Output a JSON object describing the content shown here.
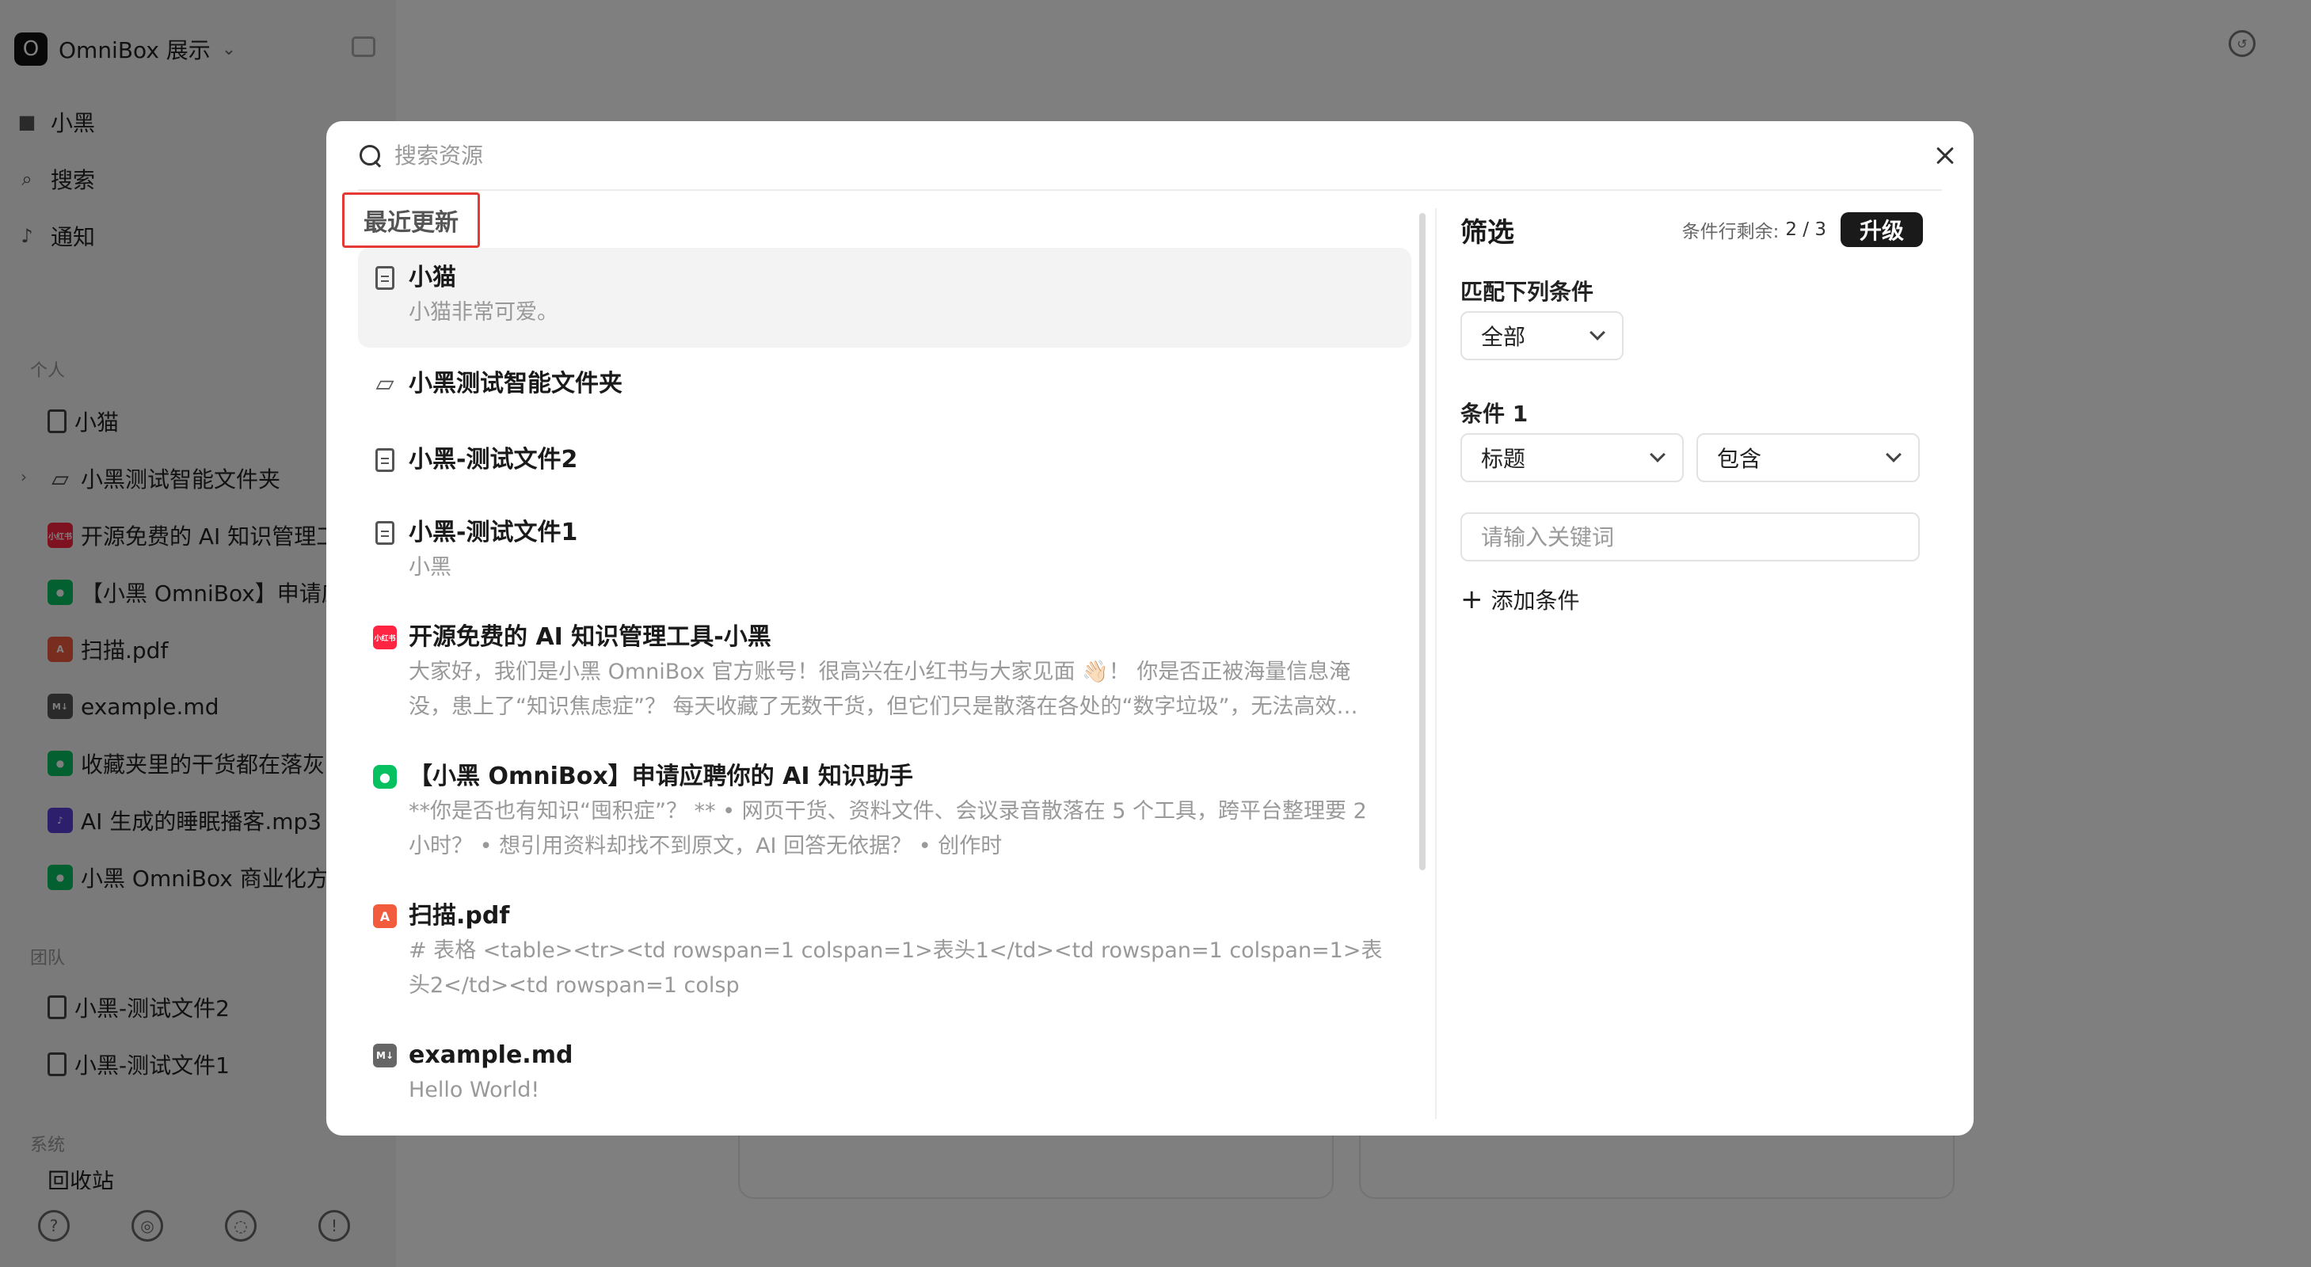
{
  "sidebar": {
    "workspace_name": "OmniBox 展示",
    "nav": [
      {
        "label": "小黑",
        "icon": "avatar-icon"
      },
      {
        "label": "搜索",
        "icon": "search-icon"
      },
      {
        "label": "通知",
        "icon": "bell-icon"
      }
    ],
    "section_personal": "个人",
    "personal_items": [
      {
        "label": "小猫",
        "icon": "document-icon"
      },
      {
        "label": "小黑测试智能文件夹",
        "icon": "smart-folder-icon"
      },
      {
        "label": "开源免费的 AI 知识管理工具-小黑",
        "icon": "xiaohongshu-icon"
      },
      {
        "label": "【小黑 OmniBox】申请应聘你的 AI 知识助手",
        "icon": "wechat-icon"
      },
      {
        "label": "扫描.pdf",
        "icon": "pdf-icon"
      },
      {
        "label": "example.md",
        "icon": "markdown-icon"
      },
      {
        "label": "收藏夹里的干货都在落灰",
        "icon": "wechat-icon"
      },
      {
        "label": "AI 生成的睡眠播客.mp3",
        "icon": "audio-icon"
      },
      {
        "label": "小黑 OmniBox 商业化方案",
        "icon": "wechat-icon"
      }
    ],
    "section_team": "团队",
    "team_items": [
      {
        "label": "小黑-测试文件2",
        "icon": "document-icon"
      },
      {
        "label": "小黑-测试文件1",
        "icon": "document-icon"
      }
    ],
    "section_system": "系统",
    "system_partial": "回收站"
  },
  "modal": {
    "search_placeholder": "搜索资源",
    "recent_label": "最近更新",
    "results": [
      {
        "title": "小猫",
        "snippet": "小猫非常可爱。",
        "icon": "document-icon"
      },
      {
        "title": "小黑测试智能文件夹",
        "snippet": "",
        "icon": "smart-folder-icon"
      },
      {
        "title": "小黑-测试文件2",
        "snippet": "",
        "icon": "document-icon"
      },
      {
        "title": "小黑-测试文件1",
        "snippet": "小黑",
        "icon": "document-icon"
      },
      {
        "title": "开源免费的 AI 知识管理工具-小黑",
        "snippet": "大家好，我们是小黑 OmniBox 官方账号！很高兴在小红书与大家见面 👋🏻！ 你是否正被海量信息淹没，患上了“知识焦虑症”？ 每天收藏了无数干货，但它们只是散落在各处的“数字垃圾”，无法高效…",
        "icon": "xiaohongshu-icon",
        "badge": "小红书"
      },
      {
        "title": "【小黑 OmniBox】申请应聘你的 AI 知识助手",
        "snippet": "**你是否也有知识“囤积症”？ ** • 网页干货、资料文件、会议录音散落在 5 个工具，跨平台整理要 2 小时？ • 想引用资料却找不到原文，AI 回答无依据？ • 创作时",
        "icon": "wechat-icon"
      },
      {
        "title": "扫描.pdf",
        "snippet": "# 表格 <table><tr><td rowspan=1 colspan=1>表头1</td><td rowspan=1 colspan=1>表头2</td><td rowspan=1 colsp",
        "icon": "pdf-icon"
      },
      {
        "title": "example.md",
        "snippet": "Hello World!",
        "icon": "markdown-icon",
        "badge": "M↓"
      }
    ],
    "filter": {
      "title": "筛选",
      "remaining_label": "条件行剩余:",
      "remaining_count": "2 / 3",
      "upgrade_label": "升级",
      "match_label": "匹配下列条件",
      "match_value": "全部",
      "condition_label": "条件 1",
      "field_value": "标题",
      "operator_value": "包含",
      "keyword_placeholder": "请输入关键词",
      "add_condition_label": "添加条件"
    }
  },
  "colors": {
    "accent_dark": "#1a1a1a",
    "highlight_border": "#e53935",
    "xiaohongshu": "#ff2442",
    "wechat": "#07c160",
    "pdf": "#f25b3c"
  }
}
